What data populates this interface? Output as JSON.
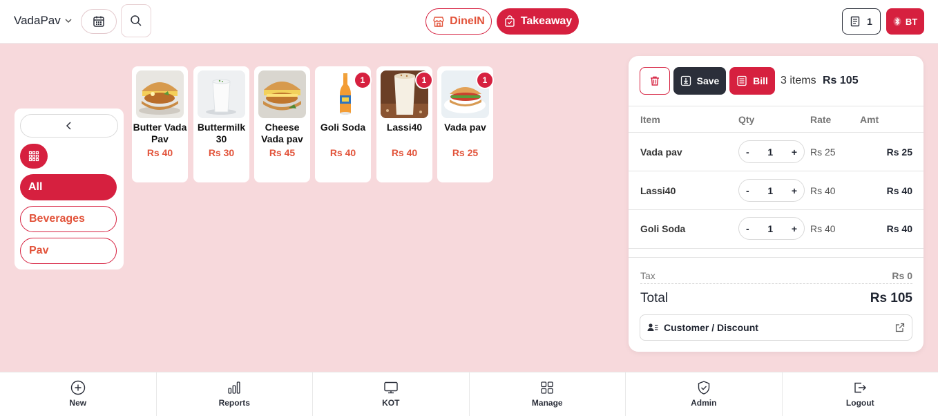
{
  "header": {
    "brand": "VadaPav",
    "dinein_label": "DineIN",
    "takeaway_label": "Takeaway",
    "counter_value": "1",
    "bt_label": "BT",
    "active_mode": "Takeaway"
  },
  "categories": {
    "items": [
      {
        "label": "All",
        "active": true
      },
      {
        "label": "Beverages",
        "active": false
      },
      {
        "label": "Pav",
        "active": false
      }
    ]
  },
  "products": [
    {
      "name": "Butter Vada Pav",
      "price": "Rs 40",
      "qty": ""
    },
    {
      "name": "Buttermilk 30",
      "price": "Rs 30",
      "qty": ""
    },
    {
      "name": "Cheese Vada pav",
      "price": "Rs 45",
      "qty": ""
    },
    {
      "name": "Goli Soda",
      "price": "Rs 40",
      "qty": "1"
    },
    {
      "name": "Lassi40",
      "price": "Rs 40",
      "qty": "1"
    },
    {
      "name": "Vada pav",
      "price": "Rs 25",
      "qty": "1"
    }
  ],
  "order": {
    "save_label": "Save",
    "bill_label": "Bill",
    "items_count": "3 items",
    "items_total": "Rs 105",
    "columns": {
      "item": "Item",
      "qty": "Qty",
      "rate": "Rate",
      "amt": "Amt"
    },
    "rows": [
      {
        "name": "Vada pav",
        "minus": "-",
        "qty": "1",
        "plus": "+",
        "rate": "Rs 25",
        "amt": "Rs 25"
      },
      {
        "name": "Lassi40",
        "minus": "-",
        "qty": "1",
        "plus": "+",
        "rate": "Rs 40",
        "amt": "Rs 40"
      },
      {
        "name": "Goli Soda",
        "minus": "-",
        "qty": "1",
        "plus": "+",
        "rate": "Rs 40",
        "amt": "Rs 40"
      }
    ],
    "tax_label": "Tax",
    "tax_value": "Rs 0",
    "total_label": "Total",
    "total_value": "Rs 105",
    "customer_label": "Customer / Discount"
  },
  "bottom_nav": {
    "items": [
      {
        "label": "New",
        "icon": "plus-circle-icon"
      },
      {
        "label": "Reports",
        "icon": "bar-chart-icon"
      },
      {
        "label": "KOT",
        "icon": "monitor-icon"
      },
      {
        "label": "Manage",
        "icon": "grid-icon"
      },
      {
        "label": "Admin",
        "icon": "shield-icon"
      },
      {
        "label": "Logout",
        "icon": "logout-icon"
      }
    ]
  },
  "colors": {
    "accent": "#d6203f",
    "price": "#e2533a",
    "background": "#f7d9dc",
    "dark_button": "#2b2f3a"
  }
}
